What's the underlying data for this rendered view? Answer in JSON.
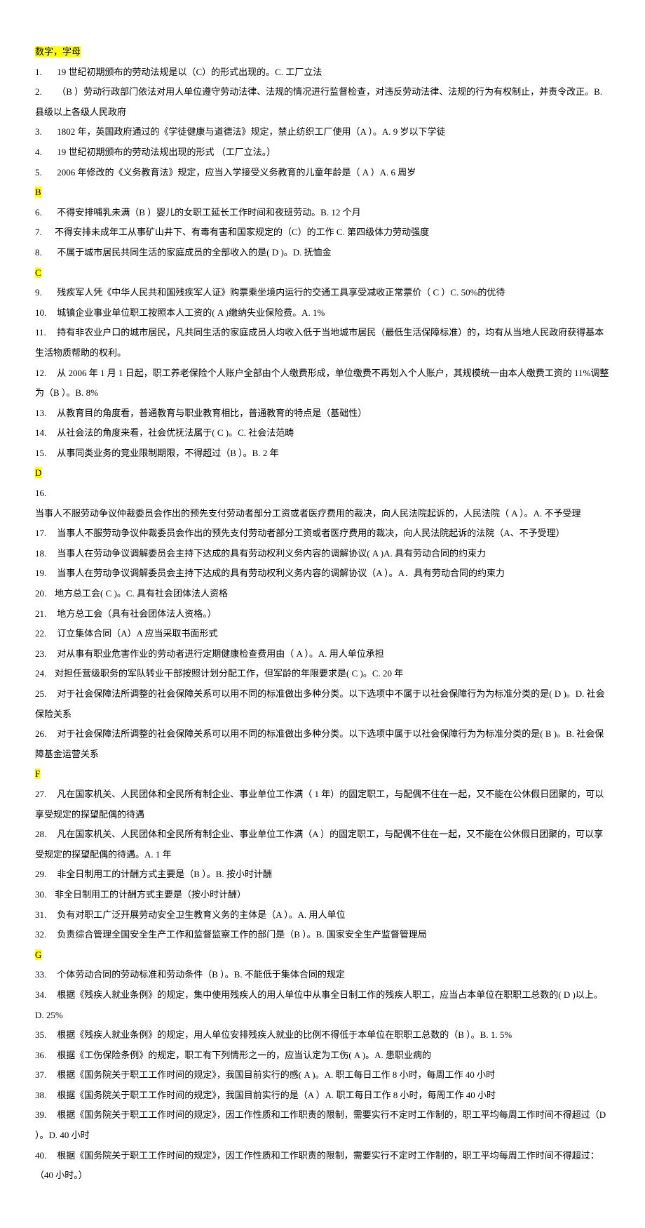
{
  "header": "数字，字母",
  "sections": [
    {
      "letter": null,
      "items": [
        {
          "n": "1.",
          "t": "19 世纪初期颁布的劳动法规是以（C）的形式出现的。C. 工厂立法"
        },
        {
          "n": "2.",
          "t": "（B  ）劳动行政部门依法对用人单位遵守劳动法律、法规的情况进行监督检查，对违反劳动法律、法规的行为有权制止，并责令改正。B. 县级以上各级人民政府"
        },
        {
          "n": "3.",
          "t": "1802 年，英国政府通过的《学徒健康与道德法》规定，禁止纺织工厂使用（A  ）。A. 9 岁以下学徒"
        },
        {
          "n": "4.",
          "t": "19 世纪初期颁布的劳动法规出现的形式 （工厂立法。）"
        },
        {
          "n": "5.",
          "t": "2006 年修改的《义务教育法》规定，应当入学接受义务教育的儿童年龄是（ A  ）A. 6 周岁"
        }
      ]
    },
    {
      "letter": "B",
      "items": [
        {
          "n": "6.",
          "t": "不得安排哺乳未满（B  ）婴儿的女职工延长工作时间和夜班劳动。B. 12 个月"
        },
        {
          "n": "7.",
          "t": "不得安排未成年工从事矿山井下、有毒有害和国家规定的（C）的工作 C. 第四级体力劳动强度",
          "noIndent": true
        },
        {
          "n": "8.",
          "t": "不属于城市居民共同生活的家庭成员的全部收入的是(  D  )。D. 抚恤金"
        }
      ]
    },
    {
      "letter": "C",
      "items": [
        {
          "n": "9.",
          "t": "残疾军人凭《中华人民共和国残疾军人证》购票乘坐境内运行的交通工具享受减收正常票价（  C  ）C. 50%的优待"
        },
        {
          "n": "10.",
          "t": "城镇企业事业单位职工按照本人工资的( A  )缴纳失业保险费。A. 1%"
        },
        {
          "n": "11.",
          "t": "持有非农业户口的城市居民，凡共同生活的家庭成员人均收入低于当地城市居民（最低生活保障标准）的，均有从当地人民政府获得基本生活物质帮助的权利。"
        },
        {
          "n": "12.",
          "t": "从 2006 年 1 月 1 日起，职工养老保险个人账户全部由个人缴费形成，单位缴费不再划入个人账户，其规模统一由本人缴费工资的 11%调整为（B  ）。B. 8%"
        },
        {
          "n": "13.",
          "t": "从教育目的角度看，普通教育与职业教育相比，普通教育的特点是（基础性）"
        },
        {
          "n": "14.",
          "t": "从社会法的角度来看，社会优抚法属于(   C  )。C. 社会法范畴"
        },
        {
          "n": "15.",
          "t": "从事同类业务的竞业限制期限，不得超过（B  ）。B. 2 年"
        }
      ]
    },
    {
      "letter": "D",
      "items": [
        {
          "n": "16.",
          "t": ""
        },
        {
          "n": "",
          "t": "当事人不服劳动争议仲裁委员会作出的预先支付劳动者部分工资或者医疗费用的裁决，向人民法院起诉的，人民法院（ A   ）。A. 不予受理",
          "noIndent": true
        },
        {
          "n": "17.",
          "t": "当事人不服劳动争议仲裁委员会作出的预先支付劳动者部分工资或者医疗费用的裁决，向人民法院起诉的法院（A、不予受理）"
        },
        {
          "n": "18.",
          "t": "当事人在劳动争议调解委员会主持下达成的具有劳动权利义务内容的调解协议(   A  )A. 具有劳动合同的约束力"
        },
        {
          "n": "19.",
          "t": "当事人在劳动争议调解委员会主持下达成的具有劳动权利义务内容的调解协议（A  ）。A．具有劳动合同的约束力"
        },
        {
          "n": "20.",
          "t": "地方总工会( C )。C. 具有社会团体法人资格",
          "noIndent": true
        },
        {
          "n": "21.",
          "t": " 地方总工会（具有社会团体法人资格。）"
        },
        {
          "n": "22.",
          "t": "订立集体合同（A）A 应当采取书面形式"
        },
        {
          "n": "23.",
          "t": "对从事有职业危害作业的劳动者进行定期健康检查费用由（ A  ）。A. 用人单位承担"
        },
        {
          "n": "24.",
          "t": "对担任营级职务的军队转业干部按照计划分配工作，但军龄的年限要求是( C   )。C. 20 年",
          "noIndent": true
        },
        {
          "n": "25.",
          "t": "对于社会保障法所调整的社会保障关系可以用不同的标准做出多种分类。以下选项中不属于以社会保障行为为标准分类的是(  D   )。D. 社会保险关系"
        },
        {
          "n": "26.",
          "t": "对于社会保障法所调整的社会保障关系可以用不同的标准做出多种分类。以下选项中属于以社会保障行为为标准分类的是(   B  )。B. 社会保障基金运营关系"
        }
      ]
    },
    {
      "letter": "F",
      "items": [
        {
          "n": "27.",
          "t": "凡在国家机关、人民团体和全民所有制企业、事业单位工作满（ 1 年）的固定职工，与配偶不住在一起，又不能在公休假日团聚的，可以享受规定的探望配偶的待遇"
        },
        {
          "n": "28.",
          "t": "凡在国家机关、人民团体和全民所有制企业、事业单位工作满（A  ）的固定职工，与配偶不住在一起，又不能在公休假日团聚的，可以享受规定的探望配偶的待遇。A. 1 年"
        },
        {
          "n": "29.",
          "t": "非全日制用工的计酬方式主要是（B  ）。B. 按小时计酬"
        },
        {
          "n": "30.",
          "t": "非全日制用工的计酬方式主要是（按小时计酬）",
          "noIndent": true
        },
        {
          "n": "31.",
          "t": "负有对职工广泛开展劳动安全卫生教育义务的主体是（A  ）。A. 用人单位"
        },
        {
          "n": "32.",
          "t": "负责综合管理全国安全生产工作和监督监察工作的部门是（B  ）。B. 国家安全生产监督管理局"
        }
      ]
    },
    {
      "letter": "G",
      "items": [
        {
          "n": "33.",
          "t": "个体劳动合同的劳动标准和劳动条件（B  ）。B. 不能低于集体合同的规定"
        },
        {
          "n": "34.",
          "t": "根据《残疾人就业条例》的规定，集中使用残疾人的用人单位中从事全日制工作的残疾人职工，应当占本单位在职职工总数的( D   )以上。D. 25%"
        },
        {
          "n": "35.",
          "t": "根据《残疾人就业条例》的规定，用人单位安排残疾人就业的比例不得低于本单位在职职工总数的（B  ）。B. 1. 5%"
        },
        {
          "n": "36.",
          "t": "根据《工伤保险条例》的规定，职工有下列情形之一的，应当认定为工伤(   A  )。A. 患职业病的"
        },
        {
          "n": "37.",
          "t": "根据《国务院关于职工工作时间的规定》，我国目前实行的感(   A  )。A. 职工每日工作 8 小时，每周工作 40 小时"
        },
        {
          "n": "38.",
          "t": "根据《国务院关于职工工作时间的规定》，我国目前实行的是（A  ）A. 职工每日工作 8 小时，每周工作 40 小时"
        },
        {
          "n": "39.",
          "t": "根据《国务院关于职工工作时间的规定》，因工作性质和工作职责的限制，需要实行不定时工作制的，职工平均每周工作时间不得超过（D  ）。D. 40 小时"
        },
        {
          "n": "40.",
          "t": "根据《国务院关于职工工作时间的规定》，因工作性质和工作职责的限制，需要实行不定时工作制的，职工平均每周工作时间不得超过：（40 小时。）"
        }
      ]
    }
  ]
}
